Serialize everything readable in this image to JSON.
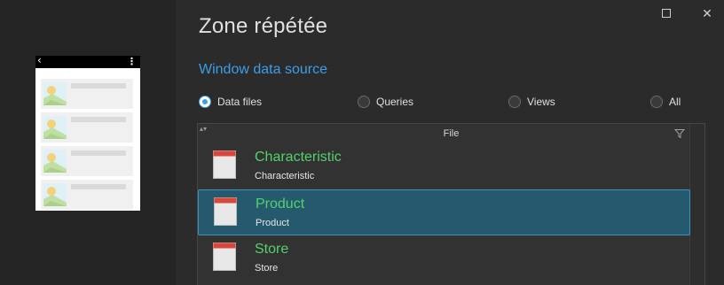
{
  "window": {
    "title": "Zone répétée",
    "maximize_icon": "maximize-icon",
    "close_icon": "close-icon",
    "close_glyph": "✕"
  },
  "preview": {
    "back_glyph": "‹",
    "more_glyph": "⋮",
    "row_count": 4
  },
  "data_source": {
    "heading": "Window data source",
    "options": [
      {
        "label": "Data files",
        "selected": true
      },
      {
        "label": "Queries",
        "selected": false
      },
      {
        "label": "Views",
        "selected": false
      },
      {
        "label": "All",
        "selected": false
      }
    ]
  },
  "table": {
    "column_header": "File",
    "sort_glyph": "▴▾",
    "rows": [
      {
        "name": "Characteristic",
        "subtitle": "Characteristic",
        "selected": false
      },
      {
        "name": "Product",
        "subtitle": "Product",
        "selected": true
      },
      {
        "name": "Store",
        "subtitle": "Store",
        "selected": false
      }
    ]
  },
  "colors": {
    "accent": "#3c9ee8",
    "item_name": "#54d16c",
    "selected_row": "#255a6e",
    "file_icon_top": "#d9463b"
  }
}
